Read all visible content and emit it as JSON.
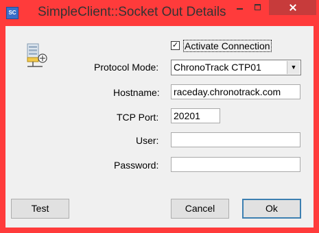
{
  "window": {
    "title": "SimpleClient::Socket Out Details",
    "app_icon_text": "SC"
  },
  "form": {
    "activate_label": "Activate Connection",
    "activate_checked": true,
    "protocol_label": "Protocol Mode:",
    "protocol_value": "ChronoTrack CTP01",
    "hostname_label": "Hostname:",
    "hostname_value": "raceday.chronotrack.com",
    "port_label": "TCP Port:",
    "port_value": "20201",
    "user_label": "User:",
    "user_value": "",
    "password_label": "Password:",
    "password_value": ""
  },
  "buttons": {
    "test": "Test",
    "cancel": "Cancel",
    "ok": "Ok"
  },
  "icons": {
    "checkmark": "✓",
    "dropdown": "▼"
  }
}
